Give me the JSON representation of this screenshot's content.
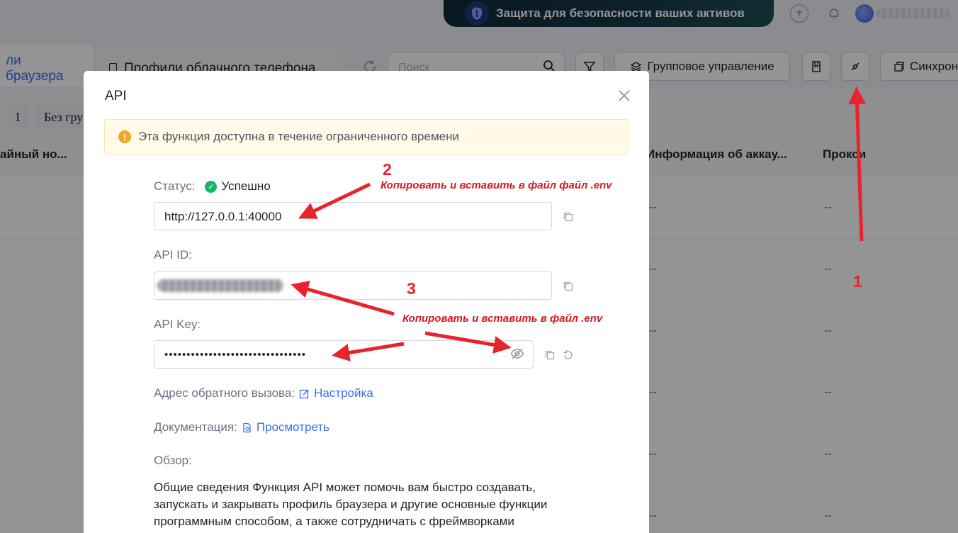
{
  "topbar": {
    "banner_text": "Защита для безопасности ваших активов"
  },
  "tabs": [
    {
      "label": "ли браузера"
    },
    {
      "label": "Профили облачного телефона"
    }
  ],
  "toolbar": {
    "search_placeholder": "Поиск",
    "group_management_label": "Групповое управление",
    "sync_label": "Синхрон"
  },
  "filters": {
    "page_number": "1",
    "group_label": "Без гру"
  },
  "table": {
    "headers": [
      "айный но...",
      "Информация об аккау...",
      "Прокси"
    ],
    "empty_value": "--"
  },
  "modal": {
    "title": "API",
    "alert_text": "Эта функция доступна в течение ограниченного времени",
    "status_label": "Статус:",
    "status_value": "Успешно",
    "url_value": "http://127.0.0.1:40000",
    "api_id_label": "API ID:",
    "api_key_label": "API Key:",
    "api_key_value": "••••••••••••••••••••••••••••••••",
    "callback_label": "Адрес обратного вызова:",
    "callback_link": "Настройка",
    "docs_label": "Документация:",
    "docs_link": "Просмотреть",
    "overview_label": "Обзор:",
    "overview_text": "Общие сведения Функция API может помочь вам быстро создавать, запускать и закрывать профиль браузера и другие основные функции программным способом, а также сотрудничать с фреймворками"
  },
  "annotations": {
    "step1": "1",
    "step2": "2",
    "step3": "3",
    "note_url": "Копировать и вставить в файл  файл .env",
    "note_credentials": "Копировать и вставить в файл .env",
    "color": "#e8232b"
  }
}
